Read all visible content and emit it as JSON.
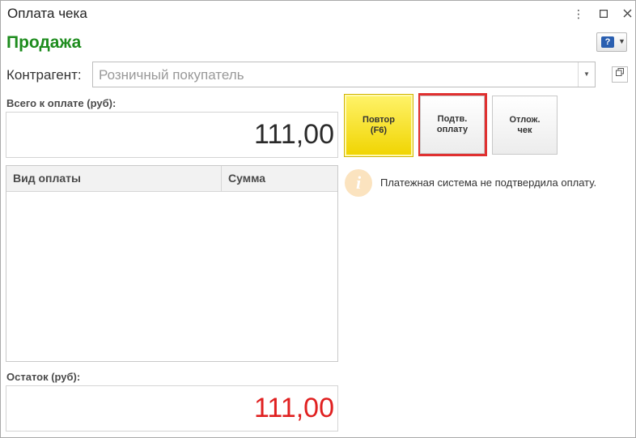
{
  "window": {
    "title": "Оплата чека",
    "menu_icon": "more-vertical-icon",
    "maximize_icon": "maximize-icon",
    "close_icon": "close-icon"
  },
  "header": {
    "title": "Продажа",
    "title_color": "#1e8c1e",
    "help_icon": "help-icon"
  },
  "counterparty": {
    "label": "Контрагент:",
    "placeholder": "Розничный покупатель",
    "value": ""
  },
  "totals": {
    "total_label": "Всего к оплате (руб):",
    "total_value": "111,00",
    "remainder_label": "Остаток (руб):",
    "remainder_value": "111,00",
    "remainder_color": "#e02020"
  },
  "payments_table": {
    "columns": [
      "Вид оплаты",
      "Сумма"
    ],
    "rows": []
  },
  "actions": {
    "retry_label": "Повтор\n(F6)",
    "confirm_label": "Подтв.\nоплату",
    "postpone_label": "Отлож.\nчек"
  },
  "message": {
    "icon": "info-icon",
    "text": "Платежная система не подтвердила оплату."
  }
}
